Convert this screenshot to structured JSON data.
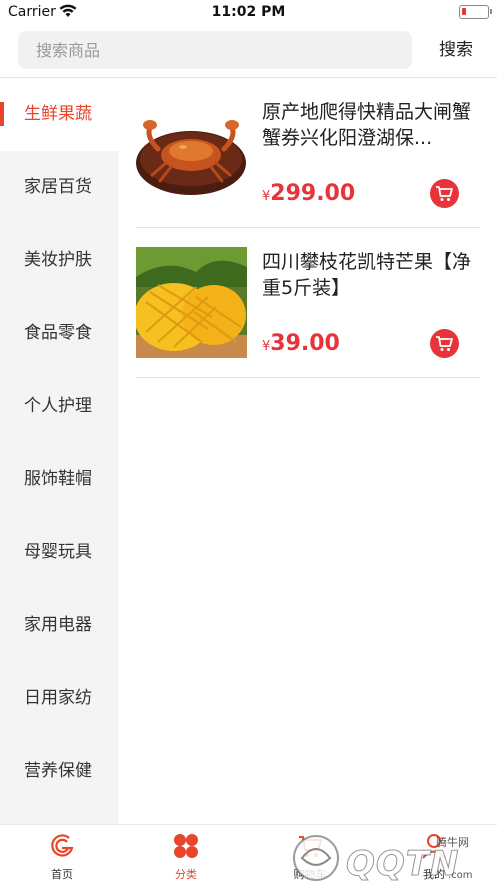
{
  "status_bar": {
    "carrier": "Carrier",
    "time": "11:02 PM",
    "battery_level": 0.15
  },
  "search": {
    "placeholder": "搜索商品",
    "value": "",
    "button_label": "搜索"
  },
  "sidebar": {
    "items": [
      {
        "label": "生鲜果蔬",
        "active": true
      },
      {
        "label": "家居百货",
        "active": false
      },
      {
        "label": "美妆护肤",
        "active": false
      },
      {
        "label": "食品零食",
        "active": false
      },
      {
        "label": "个人护理",
        "active": false
      },
      {
        "label": "服饰鞋帽",
        "active": false
      },
      {
        "label": "母婴玩具",
        "active": false
      },
      {
        "label": "家用电器",
        "active": false
      },
      {
        "label": "日用家纺",
        "active": false
      },
      {
        "label": "营养保健",
        "active": false
      }
    ]
  },
  "products": [
    {
      "title": "原产地爬得快精品大闸蟹蟹券兴化阳澄湖保...",
      "currency": "¥",
      "price": "299.00",
      "image": "hairy-crab-image"
    },
    {
      "title": "四川攀枝花凯特芒果【净重5斤装】",
      "currency": "¥",
      "price": "39.00",
      "image": "mango-image"
    }
  ],
  "tabbar": {
    "items": [
      {
        "label": "首页",
        "icon": "home-logo-icon",
        "active": false
      },
      {
        "label": "分类",
        "icon": "category-grid-icon",
        "active": true
      },
      {
        "label": "购物车",
        "icon": "cart-icon",
        "active": false
      },
      {
        "label": "我的",
        "icon": "profile-icon",
        "active": false
      }
    ]
  },
  "watermark": {
    "text": "QQTN",
    "small": "腾牛网",
    "tld": ".com"
  },
  "colors": {
    "accent": "#e8452a",
    "price": "#e8333a",
    "sidebar_bg": "#f4f4f4"
  }
}
